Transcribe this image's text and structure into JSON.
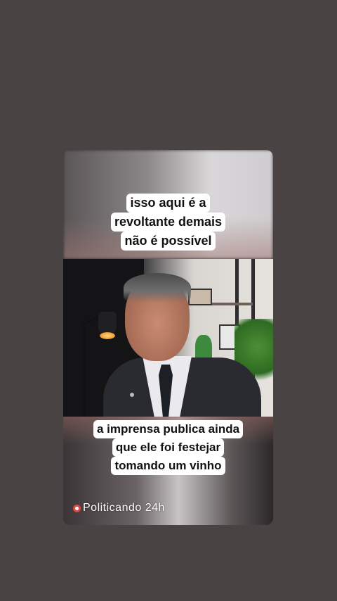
{
  "caption_top": {
    "lines": [
      "isso aqui é a",
      "revoltante demais",
      "não é possível"
    ]
  },
  "caption_bottom": {
    "lines": [
      "a imprensa publica ainda",
      "que ele foi festejar",
      "tomando um vinho"
    ]
  },
  "watermark": {
    "text": "Politicando 24h",
    "icon": "record-icon",
    "icon_color": "#e0493c"
  },
  "colors": {
    "background": "#4a4344",
    "caption_bg": "#ffffff",
    "caption_text": "#111111"
  }
}
